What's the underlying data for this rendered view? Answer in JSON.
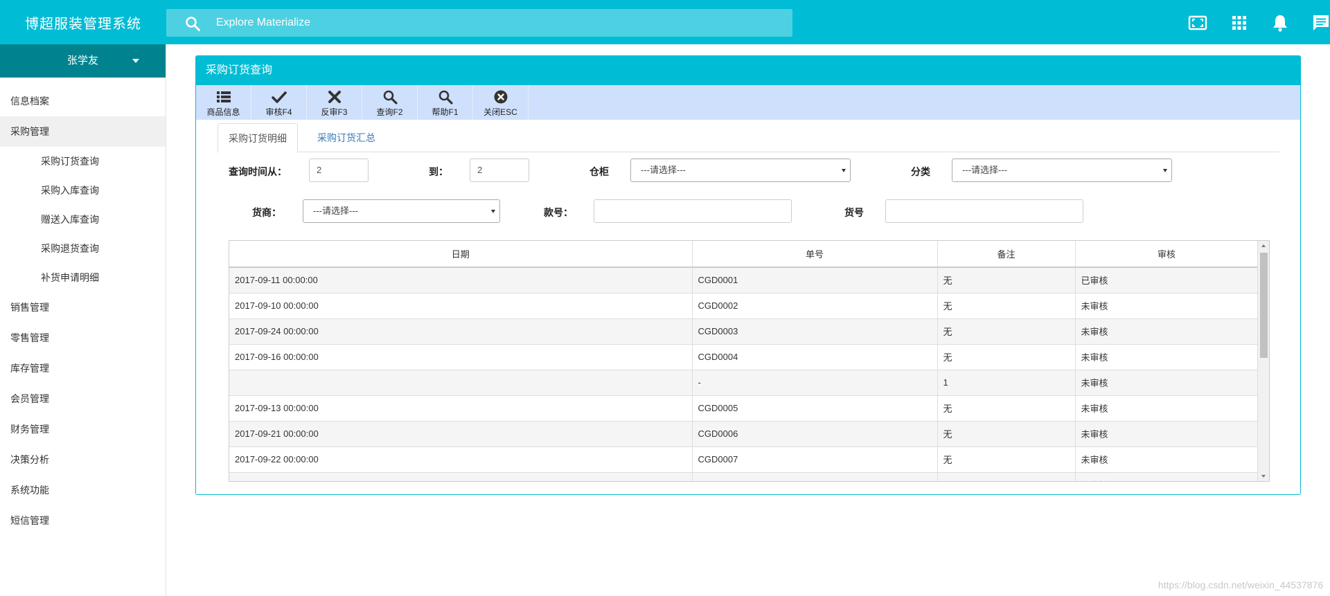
{
  "app": {
    "title": "博超服装管理系统"
  },
  "search": {
    "placeholder": "Explore Materialize"
  },
  "topbar": {
    "icons": [
      "fullscreen-icon",
      "apps-grid-icon",
      "notifications-bell-icon",
      "chat-message-icon"
    ]
  },
  "user": {
    "name": "张学友"
  },
  "sidebar": {
    "items": [
      {
        "label": "信息档案"
      },
      {
        "label": "采购管理",
        "active": true
      },
      {
        "label": "销售管理"
      },
      {
        "label": "零售管理"
      },
      {
        "label": "库存管理"
      },
      {
        "label": "会员管理"
      },
      {
        "label": "财务管理"
      },
      {
        "label": "决策分析"
      },
      {
        "label": "系统功能"
      },
      {
        "label": "短信管理"
      }
    ],
    "submenu": [
      {
        "label": "采购订货查询"
      },
      {
        "label": "采购入库查询"
      },
      {
        "label": "赠送入库查询"
      },
      {
        "label": "采购退货查询"
      },
      {
        "label": "补货申请明细"
      }
    ]
  },
  "panel": {
    "title": "采购订货查询"
  },
  "toolbar": {
    "product_info": "商品信息",
    "approve": "审核F4",
    "unapprove": "反审F3",
    "query": "查询F2",
    "help": "帮助F1",
    "close": "关闭ESC"
  },
  "tabs": {
    "detail": "采购订货明细",
    "summary": "采购订货汇总"
  },
  "filters": {
    "date_from_label": "查询时间从：",
    "date_from_value": "2",
    "date_to_label": "到：",
    "date_to_value": "2",
    "cabinet_label": "仓柜",
    "cabinet_value": "---请选择---",
    "category_label": "分类",
    "category_value": "---请选择---",
    "supplier_label": "货商：",
    "supplier_value": "---请选择---",
    "style_no_label": "款号：",
    "style_no_value": "",
    "item_no_label": "货号",
    "item_no_value": ""
  },
  "table": {
    "columns": [
      "日期",
      "单号",
      "备注",
      "审核"
    ],
    "rows": [
      [
        "2017-09-11 00:00:00",
        "CGD0001",
        "无",
        "已审核"
      ],
      [
        "2017-09-10 00:00:00",
        "CGD0002",
        "无",
        "未审核"
      ],
      [
        "2017-09-24 00:00:00",
        "CGD0003",
        "无",
        "未审核"
      ],
      [
        "2017-09-16 00:00:00",
        "CGD0004",
        "无",
        "未审核"
      ],
      [
        "",
        "-",
        "1",
        "未审核"
      ],
      [
        "2017-09-13 00:00:00",
        "CGD0005",
        "无",
        "未审核"
      ],
      [
        "2017-09-21 00:00:00",
        "CGD0006",
        "无",
        "未审核"
      ],
      [
        "2017-09-22 00:00:00",
        "CGD0007",
        "无",
        "未审核"
      ],
      [
        "",
        "",
        "无",
        "未审核"
      ]
    ]
  },
  "watermark": "https://blog.csdn.net/weixin_44537876",
  "colors": {
    "primary": "#00bcd4",
    "user_bar": "#00838f",
    "toolbar": "#cfe0fc",
    "link": "#337ab7"
  }
}
